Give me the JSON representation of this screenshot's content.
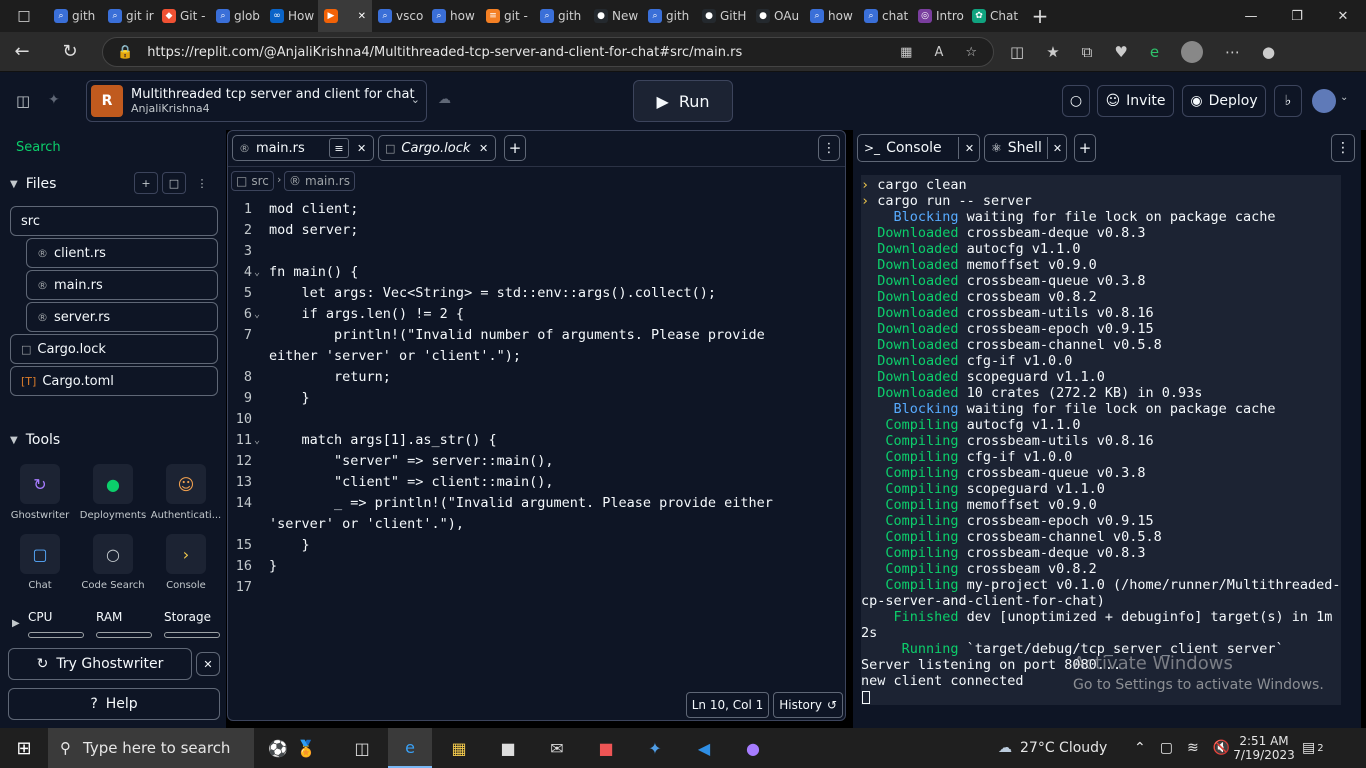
{
  "browser": {
    "tabs": [
      {
        "label": "gith",
        "icon": "search-icon"
      },
      {
        "label": "git ir",
        "icon": "search-icon"
      },
      {
        "label": "Git -",
        "icon": "git-icon"
      },
      {
        "label": "glob",
        "icon": "search-icon"
      },
      {
        "label": "How",
        "icon": "meta-icon"
      },
      {
        "label": "",
        "icon": "replit-icon",
        "active": true
      },
      {
        "label": "vsco",
        "icon": "search-icon"
      },
      {
        "label": "how",
        "icon": "search-icon"
      },
      {
        "label": "git -",
        "icon": "stack-icon"
      },
      {
        "label": "gith",
        "icon": "search-icon"
      },
      {
        "label": "New",
        "icon": "github-icon"
      },
      {
        "label": "gith",
        "icon": "search-icon"
      },
      {
        "label": "GitH",
        "icon": "github-icon"
      },
      {
        "label": "OAu",
        "icon": "github-icon"
      },
      {
        "label": "how",
        "icon": "search-icon"
      },
      {
        "label": "chat",
        "icon": "search-icon"
      },
      {
        "label": "Intro",
        "icon": "course-icon"
      },
      {
        "label": "Chat",
        "icon": "chatgpt-icon"
      }
    ],
    "url": "https://replit.com/@AnjaliKrishna4/Multithreaded-tcp-server-and-client-for-chat#src/main.rs"
  },
  "header": {
    "project_title": "Multithreaded tcp server and client for chat",
    "owner": "AnjaliKrishna4",
    "run_label": "Run",
    "invite_label": "Invite",
    "deploy_label": "Deploy"
  },
  "sidebar": {
    "search_label": "Search",
    "files_label": "Files",
    "files": [
      {
        "name": "src",
        "type": "folder"
      },
      {
        "name": "client.rs",
        "type": "rust"
      },
      {
        "name": "main.rs",
        "type": "rust"
      },
      {
        "name": "server.rs",
        "type": "rust"
      },
      {
        "name": "Cargo.lock",
        "type": "file"
      },
      {
        "name": "Cargo.toml",
        "type": "toml"
      }
    ],
    "tools_label": "Tools",
    "tools": [
      {
        "name": "Ghostwriter",
        "color": "#a67cff"
      },
      {
        "name": "Deployments",
        "color": "#0cce6b"
      },
      {
        "name": "Authenticati...",
        "color": "#f2a14f"
      },
      {
        "name": "Chat",
        "color": "#57abff"
      },
      {
        "name": "Code Search",
        "color": "#c2c8cc"
      },
      {
        "name": "Console",
        "color": "#f2c94c"
      }
    ],
    "resources": [
      "CPU",
      "RAM",
      "Storage"
    ],
    "ghostwriter_btn": "Try Ghostwriter",
    "help_btn": "Help"
  },
  "editor": {
    "tabs": [
      "main.rs",
      "Cargo.lock"
    ],
    "breadcrumb": [
      "src",
      "main.rs"
    ],
    "lines": [
      {
        "n": "1",
        "text": "mod client;",
        "fold": false
      },
      {
        "n": "2",
        "text": "mod server;",
        "fold": false
      },
      {
        "n": "3",
        "text": "",
        "fold": false
      },
      {
        "n": "4",
        "text": "fn main() {",
        "fold": true
      },
      {
        "n": "5",
        "text": "    let args: Vec<String> = std::env::args().collect();",
        "fold": false
      },
      {
        "n": "6",
        "text": "    if args.len() != 2 {",
        "fold": true
      },
      {
        "n": "7",
        "text": "        println!(\"Invalid number of arguments. Please provide",
        "fold": false
      },
      {
        "n": "",
        "text": "either 'server' or 'client'.\");",
        "fold": false
      },
      {
        "n": "8",
        "text": "        return;",
        "fold": false
      },
      {
        "n": "9",
        "text": "    }",
        "fold": false
      },
      {
        "n": "10",
        "text": "",
        "fold": false
      },
      {
        "n": "11",
        "text": "    match args[1].as_str() {",
        "fold": true
      },
      {
        "n": "12",
        "text": "        \"server\" => server::main(),",
        "fold": false
      },
      {
        "n": "13",
        "text": "        \"client\" => client::main(),",
        "fold": false
      },
      {
        "n": "14",
        "text": "        _ => println!(\"Invalid argument. Please provide either",
        "fold": false
      },
      {
        "n": "",
        "text": "'server' or 'client'.\"),",
        "fold": false
      },
      {
        "n": "15",
        "text": "    }",
        "fold": false
      },
      {
        "n": "16",
        "text": "}",
        "fold": false
      },
      {
        "n": "17",
        "text": "",
        "fold": false
      }
    ],
    "cursor_pos": "Ln 10, Col 1",
    "history_label": "History"
  },
  "console": {
    "tabs": [
      "Console",
      "Shell"
    ],
    "lines": [
      {
        "pre": "› ",
        "kw": "",
        "rest": "cargo clean",
        "c": "y"
      },
      {
        "pre": "› ",
        "kw": "",
        "rest": "cargo run -- server",
        "c": "y"
      },
      {
        "pre": "    ",
        "kw": "Blocking",
        "rest": " waiting for file lock on package cache",
        "c": "b"
      },
      {
        "pre": "  ",
        "kw": "Downloaded",
        "rest": " crossbeam-deque v0.8.3",
        "c": "g"
      },
      {
        "pre": "  ",
        "kw": "Downloaded",
        "rest": " autocfg v1.1.0",
        "c": "g"
      },
      {
        "pre": "  ",
        "kw": "Downloaded",
        "rest": " memoffset v0.9.0",
        "c": "g"
      },
      {
        "pre": "  ",
        "kw": "Downloaded",
        "rest": " crossbeam-queue v0.3.8",
        "c": "g"
      },
      {
        "pre": "  ",
        "kw": "Downloaded",
        "rest": " crossbeam v0.8.2",
        "c": "g"
      },
      {
        "pre": "  ",
        "kw": "Downloaded",
        "rest": " crossbeam-utils v0.8.16",
        "c": "g"
      },
      {
        "pre": "  ",
        "kw": "Downloaded",
        "rest": " crossbeam-epoch v0.9.15",
        "c": "g"
      },
      {
        "pre": "  ",
        "kw": "Downloaded",
        "rest": " crossbeam-channel v0.5.8",
        "c": "g"
      },
      {
        "pre": "  ",
        "kw": "Downloaded",
        "rest": " cfg-if v1.0.0",
        "c": "g"
      },
      {
        "pre": "  ",
        "kw": "Downloaded",
        "rest": " scopeguard v1.1.0",
        "c": "g"
      },
      {
        "pre": "  ",
        "kw": "Downloaded",
        "rest": " 10 crates (272.2 KB) in 0.93s",
        "c": "g"
      },
      {
        "pre": "    ",
        "kw": "Blocking",
        "rest": " waiting for file lock on package cache",
        "c": "b"
      },
      {
        "pre": "   ",
        "kw": "Compiling",
        "rest": " autocfg v1.1.0",
        "c": "g"
      },
      {
        "pre": "   ",
        "kw": "Compiling",
        "rest": " crossbeam-utils v0.8.16",
        "c": "g"
      },
      {
        "pre": "   ",
        "kw": "Compiling",
        "rest": " cfg-if v1.0.0",
        "c": "g"
      },
      {
        "pre": "   ",
        "kw": "Compiling",
        "rest": " crossbeam-queue v0.3.8",
        "c": "g"
      },
      {
        "pre": "   ",
        "kw": "Compiling",
        "rest": " scopeguard v1.1.0",
        "c": "g"
      },
      {
        "pre": "   ",
        "kw": "Compiling",
        "rest": " memoffset v0.9.0",
        "c": "g"
      },
      {
        "pre": "   ",
        "kw": "Compiling",
        "rest": " crossbeam-epoch v0.9.15",
        "c": "g"
      },
      {
        "pre": "   ",
        "kw": "Compiling",
        "rest": " crossbeam-channel v0.5.8",
        "c": "g"
      },
      {
        "pre": "   ",
        "kw": "Compiling",
        "rest": " crossbeam-deque v0.8.3",
        "c": "g"
      },
      {
        "pre": "   ",
        "kw": "Compiling",
        "rest": " crossbeam v0.8.2",
        "c": "g"
      },
      {
        "pre": "   ",
        "kw": "Compiling",
        "rest": " my-project v0.1.0 (/home/runner/Multithreaded-t",
        "c": "g"
      },
      {
        "pre": "",
        "kw": "",
        "rest": "cp-server-and-client-for-chat)",
        "c": ""
      },
      {
        "pre": "    ",
        "kw": "Finished",
        "rest": " dev [unoptimized + debuginfo] target(s) in 1m 1",
        "c": "g"
      },
      {
        "pre": "",
        "kw": "",
        "rest": "2s",
        "c": ""
      },
      {
        "pre": "     ",
        "kw": "Running",
        "rest": " `target/debug/tcp_server_client server`",
        "c": "g"
      },
      {
        "pre": "",
        "kw": "",
        "rest": "Server listening on port 8080...",
        "c": ""
      },
      {
        "pre": "",
        "kw": "",
        "rest": "new client connected",
        "c": ""
      }
    ]
  },
  "watermark": {
    "line1": "Activate Windows",
    "line2": "Go to Settings to activate Windows."
  },
  "taskbar": {
    "search_placeholder": "Type here to search",
    "weather": "27°C  Cloudy",
    "time": "2:51 AM",
    "date": "7/19/2023",
    "notifications": "2"
  }
}
